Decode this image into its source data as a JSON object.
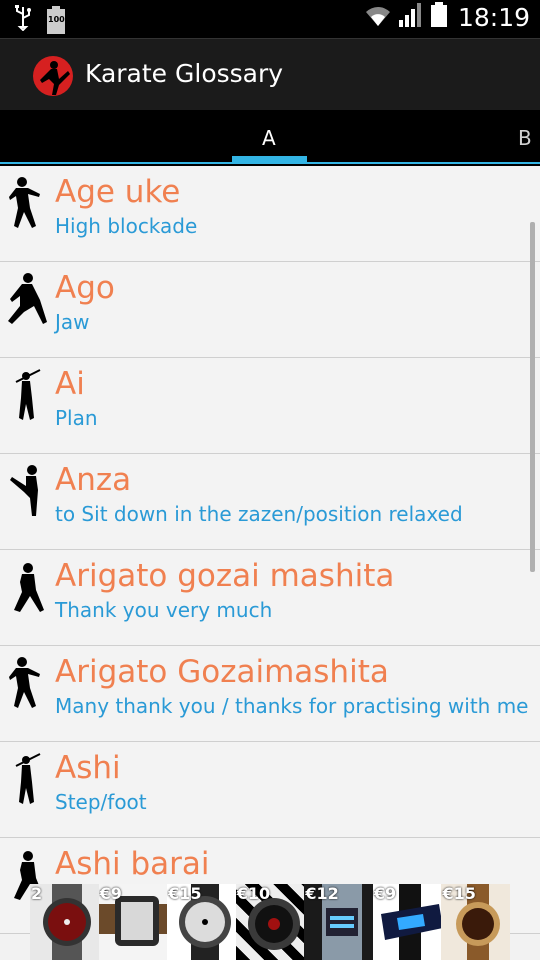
{
  "status_bar": {
    "time": "18:19",
    "battery_label": "100",
    "icons": [
      "usb-icon",
      "battery-icon",
      "wifi-icon",
      "signal-icon",
      "battery-full-icon"
    ]
  },
  "app": {
    "title": "Karate Glossary",
    "icon": "karate-logo-icon",
    "accent": "#33b5e5",
    "term_color": "#f08050",
    "meaning_color": "#2a9ad6"
  },
  "tabs": [
    {
      "label": "A",
      "selected": true
    },
    {
      "label": "B",
      "selected": false
    }
  ],
  "entries": [
    {
      "term": "Age uke",
      "meaning": "High blockade",
      "icon": "fighter-punch-icon"
    },
    {
      "term": "Ago",
      "meaning": "Jaw",
      "icon": "fighter-lunge-icon"
    },
    {
      "term": "Ai",
      "meaning": "Plan",
      "icon": "fighter-staff-icon"
    },
    {
      "term": "Anza",
      "meaning": "to Sit down in the zazen/position relaxed",
      "icon": "fighter-kick-icon"
    },
    {
      "term": "Arigato gozai mashita",
      "meaning": "Thank you very much",
      "icon": "fighter-stance-icon"
    },
    {
      "term": "Arigato Gozaimashita",
      "meaning": "Many thank you / thanks for practising with me",
      "icon": "fighter-punch-icon"
    },
    {
      "term": "Ashi",
      "meaning": "Step/foot",
      "icon": "fighter-staff-icon"
    },
    {
      "term": "Ashi barai",
      "meaning": "",
      "icon": "fighter-stance-icon"
    }
  ],
  "ad": {
    "items": [
      {
        "price": "2",
        "color": "#7a0f0f",
        "icon": "watch-icon"
      },
      {
        "price": "€9",
        "color": "#2a2a2a",
        "icon": "watch-icon"
      },
      {
        "price": "€15",
        "color": "#dcdcdc",
        "icon": "watch-icon"
      },
      {
        "price": "€10",
        "color": "#3a3a3a",
        "icon": "watch-icon"
      },
      {
        "price": "€12",
        "color": "#8a9aa8",
        "icon": "watch-icon"
      },
      {
        "price": "€9",
        "color": "#101a40",
        "icon": "watch-icon"
      },
      {
        "price": "€15",
        "color": "#c79a5a",
        "icon": "watch-icon"
      }
    ]
  }
}
